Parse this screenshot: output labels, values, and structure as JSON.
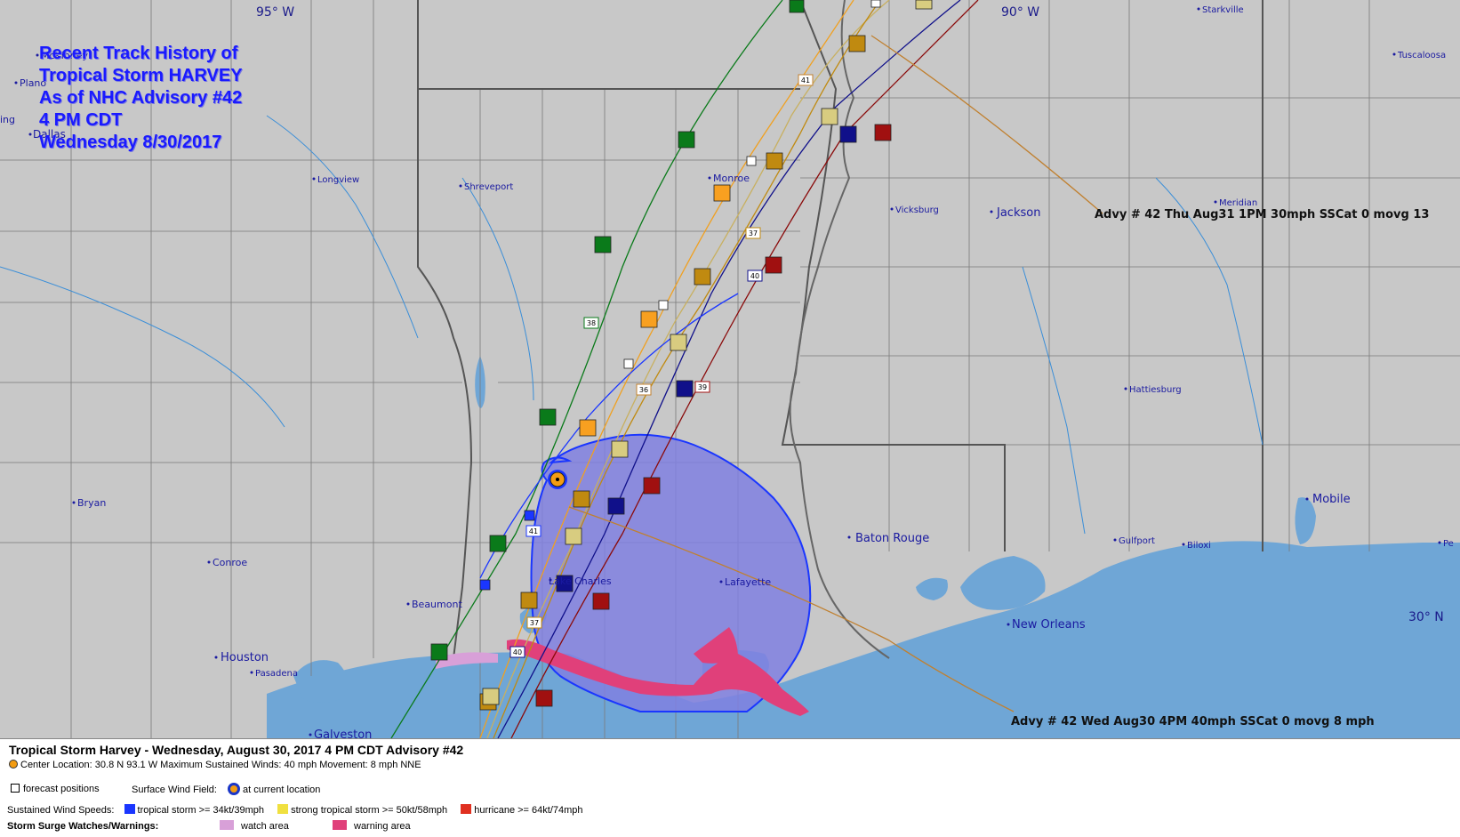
{
  "title_block": {
    "lines": [
      "Recent Track History of",
      "Tropical Storm HARVEY",
      "As of NHC Advisory #42",
      "4 PM CDT",
      "Wednesday 8/30/2017"
    ]
  },
  "coordinates": {
    "lon_95": "95° W",
    "lon_90": "90° W",
    "lat_30": "30° N"
  },
  "cities": [
    {
      "name": "Plano",
      "id": "plano"
    },
    {
      "name": "McKinney",
      "id": "mckinney"
    },
    {
      "name": "Dallas",
      "id": "dallas"
    },
    {
      "name": "ing",
      "id": "irving"
    },
    {
      "name": "Longview",
      "id": "longview"
    },
    {
      "name": "Shreveport",
      "id": "shreveport"
    },
    {
      "name": "Monroe",
      "id": "monroe"
    },
    {
      "name": "Vicksburg",
      "id": "vicksburg"
    },
    {
      "name": "Jackson",
      "id": "jackson"
    },
    {
      "name": "Meridian",
      "id": "meridian"
    },
    {
      "name": "Starkville",
      "id": "starkville"
    },
    {
      "name": "Tuscaloosa",
      "id": "tuscaloosa"
    },
    {
      "name": "Hattiesburg",
      "id": "hattiesburg"
    },
    {
      "name": "Bryan",
      "id": "bryan"
    },
    {
      "name": "Conroe",
      "id": "conroe"
    },
    {
      "name": "Beaumont",
      "id": "beaumont"
    },
    {
      "name": "Lake Charles",
      "id": "lake-charles"
    },
    {
      "name": "Lafayette",
      "id": "lafayette"
    },
    {
      "name": "Baton Rouge",
      "id": "baton-rouge"
    },
    {
      "name": "Houston",
      "id": "houston"
    },
    {
      "name": "Pasadena",
      "id": "pasadena"
    },
    {
      "name": "Galveston",
      "id": "galveston"
    },
    {
      "name": "New Orleans",
      "id": "new-orleans"
    },
    {
      "name": "Gulfport",
      "id": "gulfport"
    },
    {
      "name": "Biloxi",
      "id": "biloxi"
    },
    {
      "name": "Mobile",
      "id": "mobile"
    },
    {
      "name": "Pe",
      "id": "pensacola"
    }
  ],
  "advisory_labels": {
    "forecast_end": "Advy # 42 Thu Aug31 1PM  30mph SSCat 0 movg 13",
    "current": "Advy # 42 Wed Aug30 4PM  40mph SSCat 0 movg 8 mph"
  },
  "advisory_numbers": [
    "41",
    "38",
    "37",
    "40",
    "36",
    "39",
    "41",
    "37",
    "40"
  ],
  "legend": {
    "title": "Tropical Storm Harvey  -  Wednesday, August 30, 2017  4 PM CDT   Advisory #42",
    "center": "Center Location: 30.8 N  93.1 W   Maximum Sustained Winds: 40 mph  Movement: 8 mph NNE",
    "forecast_positions": "forecast positions",
    "surface_wind_field": "Surface Wind Field:",
    "at_current_location": "at current location",
    "sustained_wind_speeds": "Sustained Wind Speeds:",
    "ts": "tropical storm >= 34kt/39mph",
    "sts": "strong tropical storm >= 50kt/58mph",
    "hu": "hurricane >= 64kt/74mph",
    "surge": "Storm Surge Watches/Warnings:",
    "watch": "watch area",
    "warning": "warning area"
  },
  "colors": {
    "land": "#c8c8c8",
    "water": "#6fa6d6",
    "ts": "#1a36ff",
    "sts": "#f0e040",
    "hu": "#e03020",
    "wind_field": "#8080e0",
    "surge_watch": "#d8a0d8",
    "surge_warning": "#e0407a",
    "title": "#1a1aff"
  },
  "storm": {
    "center_lat": 30.8,
    "center_lon": -93.1,
    "max_winds_mph": 40,
    "movement": "8 mph NNE"
  }
}
